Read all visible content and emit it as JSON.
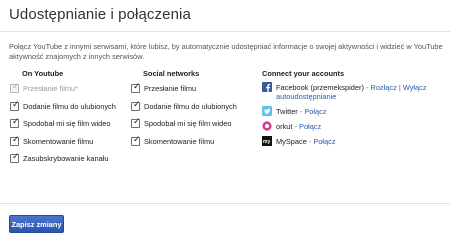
{
  "page": {
    "title": "Udostępnianie i połączenia",
    "intro": "Połącz YouTube z innymi serwisami, które lubisz, by automatycznie udostępniać informacje o swojej aktywności i widzieć w YouTube aktywność znajomych z innych serwisów."
  },
  "on_youtube": {
    "heading": "On Youtube",
    "items": [
      {
        "label": "Przesłanie filmu*",
        "checked": true,
        "disabled": true
      },
      {
        "label": "Dodanie filmu do ulubionych",
        "checked": true,
        "disabled": false
      },
      {
        "label": "Spodobał mi się film wideo",
        "checked": true,
        "disabled": false
      },
      {
        "label": "Skomentowanie filmu",
        "checked": true,
        "disabled": false
      },
      {
        "label": "Zasubskrybowanie kanału",
        "checked": true,
        "disabled": false
      }
    ]
  },
  "social_networks": {
    "heading": "Social networks",
    "items": [
      {
        "label": "Przesłanie filmu",
        "checked": true
      },
      {
        "label": "Dodanie filmu do ulubionych",
        "checked": true
      },
      {
        "label": "Spodobał mi się film wideo",
        "checked": true
      },
      {
        "label": "Skomentowanie filmu",
        "checked": true
      }
    ]
  },
  "accounts": {
    "heading": "Connect your accounts",
    "facebook": {
      "name": "Facebook (przemekspider)",
      "sep": " - ",
      "disconnect": "Rozłącz",
      "pipe": " | ",
      "disable_share": "Wyłącz autoudostępnianie",
      "icon": "facebook-icon",
      "color": "#3b5998"
    },
    "twitter": {
      "name": "Twitter",
      "sep": " - ",
      "connect": "Połącz",
      "icon": "twitter-icon",
      "color": "#5ec3ea"
    },
    "orkut": {
      "name": "orkut",
      "sep": " - ",
      "connect": "Połącz",
      "icon": "orkut-icon",
      "color": "#d33c8f"
    },
    "myspace": {
      "name": "MySpace",
      "sep": " - ",
      "connect": "Połącz",
      "icon": "myspace-icon",
      "color": "#111111"
    }
  },
  "footer": {
    "save_label": "Zapisz zmiany",
    "button_color": "#2b54ae"
  }
}
